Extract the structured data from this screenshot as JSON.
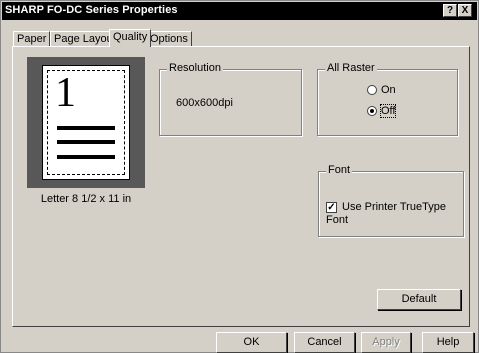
{
  "window": {
    "title": "SHARP FO-DC Series  Properties",
    "help_button": "?",
    "close_button": "X"
  },
  "tabs": [
    {
      "label": "Paper",
      "active": false
    },
    {
      "label": "Page Layout",
      "active": false
    },
    {
      "label": "Quality",
      "active": true
    },
    {
      "label": "Options",
      "active": false
    }
  ],
  "preview": {
    "page_number": "1",
    "paper_size_label": "Letter 8 1/2 x 11 in"
  },
  "resolution": {
    "group_label": "Resolution",
    "value": "600x600dpi"
  },
  "all_raster": {
    "group_label": "All Raster",
    "options": [
      {
        "label": "On",
        "checked": false
      },
      {
        "label": "Off",
        "checked": true
      }
    ]
  },
  "font": {
    "group_label": "Font",
    "use_truetype_label": "Use Printer TrueType Font",
    "use_truetype_checked": true
  },
  "buttons": {
    "default": "Default",
    "ok": "OK",
    "cancel": "Cancel",
    "apply": "Apply",
    "help": "Help"
  }
}
